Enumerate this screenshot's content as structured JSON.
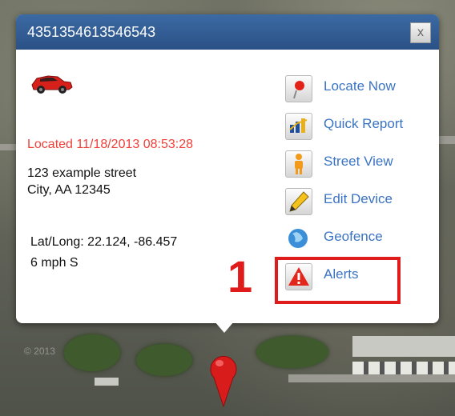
{
  "popup": {
    "device_id": "4351354613546543",
    "close_label": "x",
    "located": "Located 11/18/2013 08:53:28",
    "address_line1": "123 example street",
    "address_line2": "City, AA 12345",
    "latlong": "Lat/Long: 22.124, -86.457",
    "speed": "6 mph S"
  },
  "actions": [
    {
      "label": "Locate Now",
      "icon": "pushpin-icon"
    },
    {
      "label": "Quick Report",
      "icon": "report-icon"
    },
    {
      "label": "Street View",
      "icon": "person-icon"
    },
    {
      "label": "Edit Device",
      "icon": "pencil-icon"
    },
    {
      "label": "Geofence",
      "icon": "globe-icon"
    },
    {
      "label": "Alerts",
      "icon": "warning-icon"
    }
  ],
  "annotation": {
    "number": "1"
  },
  "colors": {
    "header": "#2f5a92",
    "located_text": "#f0403a",
    "link": "#3a73c4",
    "highlight": "#e01b1b"
  }
}
